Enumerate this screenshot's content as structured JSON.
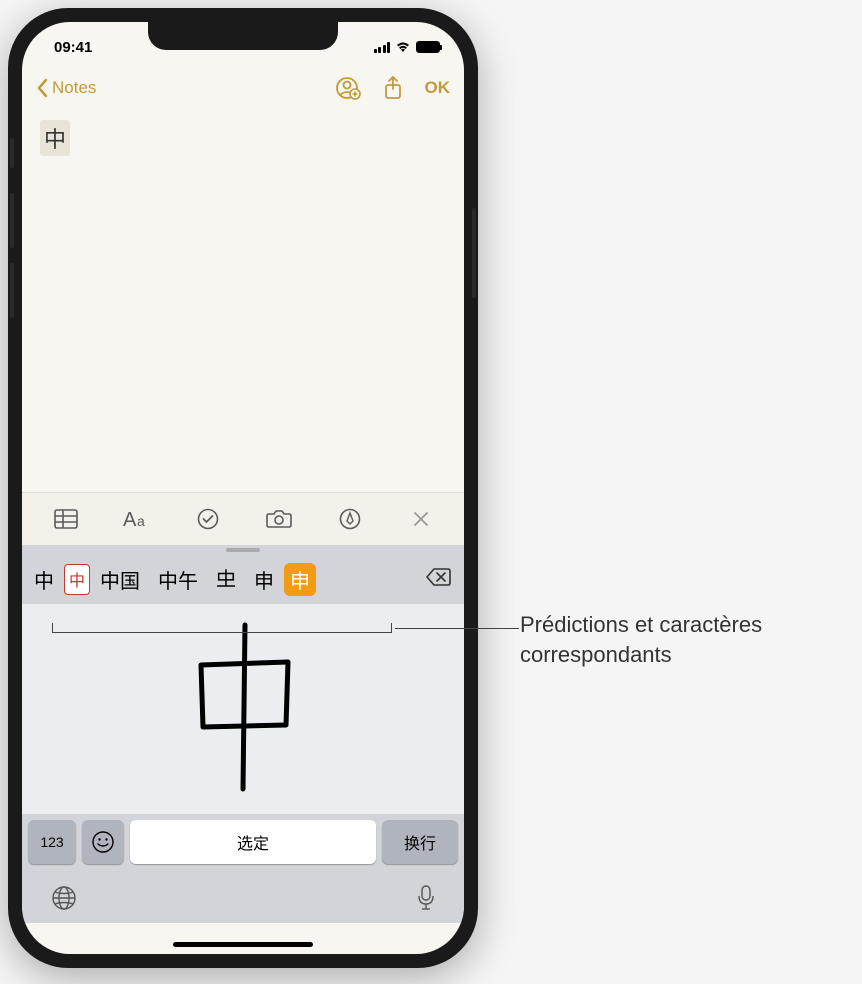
{
  "status": {
    "time": "09:41"
  },
  "nav": {
    "back_label": "Notes",
    "ok_label": "OK"
  },
  "note": {
    "typed_character": "中"
  },
  "candidates": {
    "items": [
      "中",
      "🀄",
      "中国",
      "中午",
      "𠀐",
      "申",
      "申"
    ],
    "item0": "中",
    "item1": "中",
    "item2": "中国",
    "item3": "中午",
    "item4": "𠀐",
    "item5": "申",
    "item6": "申"
  },
  "keyboard": {
    "key_123": "123",
    "space_label": "选定",
    "return_label": "换行"
  },
  "callout": {
    "text": "Prédictions et caractères correspondants"
  }
}
